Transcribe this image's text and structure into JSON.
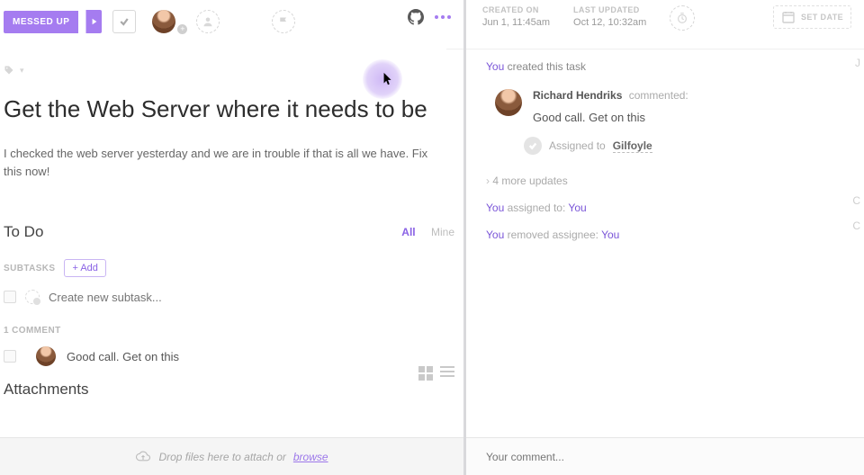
{
  "toolbar": {
    "status_label": "MESSED UP"
  },
  "meta": {
    "created_label": "CREATED ON",
    "created_value": "Jun 1, 11:45am",
    "updated_label": "LAST UPDATED",
    "updated_value": "Oct 12, 10:32am",
    "set_date_label": "SET DATE"
  },
  "task": {
    "title": "Get the Web Server where it needs to be",
    "description": "I checked the web server yesterday and we are in trouble if that is all we have. Fix this now!"
  },
  "todo": {
    "heading": "To Do",
    "filter_all": "All",
    "filter_mine": "Mine"
  },
  "subtasks": {
    "label": "SUBTASKS",
    "add_label": "+ Add",
    "new_placeholder": "Create new subtask..."
  },
  "comments": {
    "count_label": "1 COMMENT",
    "items": [
      {
        "text": "Good call. Get on this"
      }
    ]
  },
  "attachments": {
    "heading": "Attachments"
  },
  "dropzone": {
    "text": "Drop files here to attach or ",
    "browse": "browse"
  },
  "activity": {
    "created_you": "You",
    "created_rest": " created this task",
    "commenter": "Richard Hendriks",
    "comment_verb": "commented:",
    "comment_msg": "Good call. Get on this",
    "assigned_label": "Assigned to ",
    "assigned_name": "Gilfoyle",
    "more_updates": "4 more updates",
    "assign1_you": "You",
    "assign1_mid": " assigned to: ",
    "assign1_target": "You",
    "assign2_you": "You",
    "assign2_mid": " removed assignee: ",
    "assign2_target": "You",
    "comment_placeholder": "Your comment..."
  }
}
